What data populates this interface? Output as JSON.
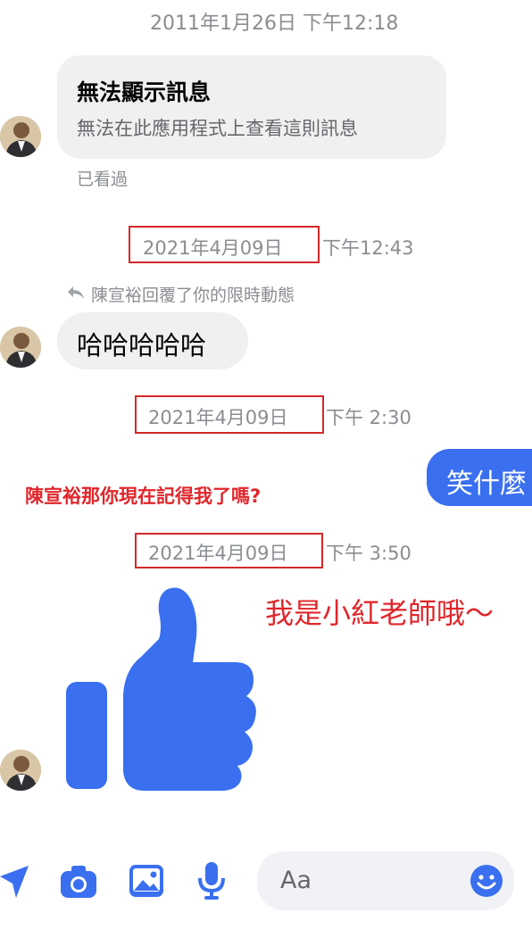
{
  "conversation": {
    "timestamp_1": "2011年1月26日 下午12:18",
    "msg_1": {
      "title": "無法顯示訊息",
      "subtitle": "無法在此應用程式上查看這則訊息"
    },
    "seen_label": "已看過",
    "timestamp_2": {
      "date": "2021年4月09日",
      "time": "下午12:43"
    },
    "reply_note": "陳宣裕回覆了你的限時動態",
    "msg_2": "哈哈哈哈哈",
    "timestamp_3": {
      "date": "2021年4月09日",
      "time": "下午 2:30"
    },
    "outgoing_msg": "笑什麼",
    "annotation_1": "陳宣裕那你現在記得我了嗎?",
    "timestamp_4": {
      "date": "2021年4月09日",
      "time": "下午 3:50"
    },
    "annotation_2": "我是小紅老師哦～",
    "like_icon": "thumbs-up-icon"
  },
  "composer": {
    "placeholder": "Aa",
    "icons": [
      "send-location-icon",
      "camera-icon",
      "image-icon",
      "microphone-icon",
      "emoji-icon"
    ]
  },
  "colors": {
    "accent_blue": "#3a6ff0",
    "annotation_red": "#e0262b",
    "timestamp_gray": "#8a8d91"
  }
}
